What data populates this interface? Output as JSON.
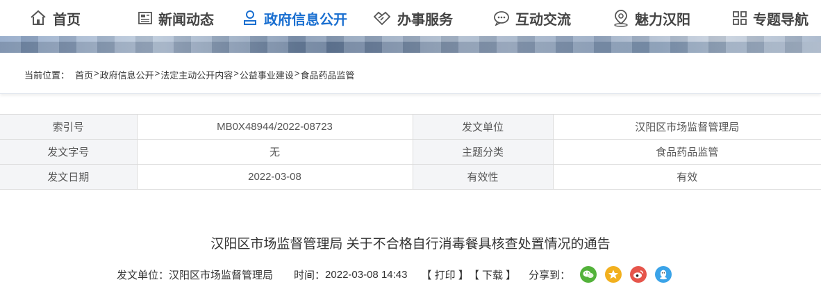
{
  "nav": {
    "items": [
      {
        "label": "首页",
        "icon": "home-icon"
      },
      {
        "label": "新闻动态",
        "icon": "news-icon"
      },
      {
        "label": "政府信息公开",
        "icon": "user-info-icon",
        "active": true
      },
      {
        "label": "办事服务",
        "icon": "handshake-icon"
      },
      {
        "label": "互动交流",
        "icon": "chat-icon"
      },
      {
        "label": "魅力汉阳",
        "icon": "location-pin-icon"
      },
      {
        "label": "专题导航",
        "icon": "grid-icon"
      }
    ],
    "active_color": "#1a6fd0"
  },
  "breadcrumb": {
    "label": "当前位置：",
    "items": [
      "首页",
      "政府信息公开",
      "法定主动公开内容",
      "公益事业建设",
      "食品药品监管"
    ],
    "separator": ">"
  },
  "meta": {
    "index_label": "索引号",
    "index_value": "MB0X48944/2022-08723",
    "issuer_label": "发文单位",
    "issuer_value": "汉阳区市场监督管理局",
    "doc_no_label": "发文字号",
    "doc_no_value": "无",
    "topic_label": "主题分类",
    "topic_value": "食品药品监管",
    "date_label": "发文日期",
    "date_value": "2022-03-08",
    "validity_label": "有效性",
    "validity_value": "有效"
  },
  "article": {
    "title": "汉阳区市场监督管理局 关于不合格自行消毒餐具核查处置情况的通告",
    "issuer_label": "发文单位：",
    "issuer": "汉阳区市场监督管理局",
    "time_label": "时间：",
    "time": "2022-03-08 14:43",
    "print_label": "【 打印 】",
    "download_label": "【 下载 】",
    "share_label": "分享到：",
    "share_icons": [
      "wechat-icon",
      "qzone-icon",
      "weibo-icon",
      "qq-icon"
    ]
  }
}
